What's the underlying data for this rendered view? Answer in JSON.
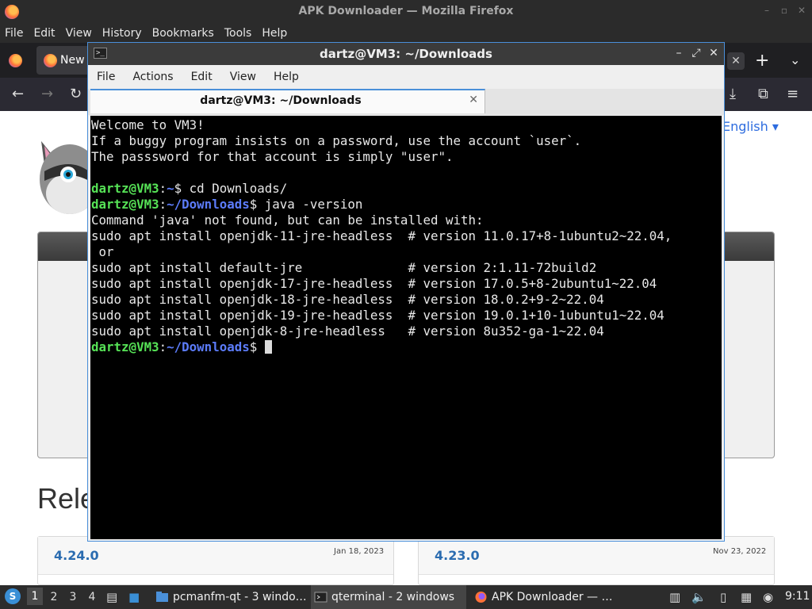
{
  "firefox": {
    "window_title": "APK Downloader — Mozilla Firefox",
    "menu": [
      "File",
      "Edit",
      "View",
      "History",
      "Bookmarks",
      "Tools",
      "Help"
    ],
    "tab_label": "New",
    "page": {
      "language": "English",
      "heading_partial": "Rele",
      "releases": [
        {
          "version": "4.24.0",
          "date": "Jan 18, 2023"
        },
        {
          "version": "4.23.0",
          "date": "Nov 23, 2022"
        }
      ]
    }
  },
  "terminal": {
    "window_title": "dartz@VM3: ~/Downloads",
    "menu": [
      "File",
      "Actions",
      "Edit",
      "View",
      "Help"
    ],
    "tab_label": "dartz@VM3: ~/Downloads",
    "lines": [
      {
        "text": "Welcome to VM3!"
      },
      {
        "text": "If a buggy program insists on a password, use the account `user`."
      },
      {
        "text": "The passsword for that account is simply \"user\"."
      },
      {
        "text": ""
      },
      {
        "user": "dartz@VM3",
        "path": "~",
        "cmd": "$ cd Downloads/"
      },
      {
        "user": "dartz@VM3",
        "path": "~/Downloads",
        "cmd": "$ java -version"
      },
      {
        "text": "Command 'java' not found, but can be installed with:"
      },
      {
        "text": "sudo apt install openjdk-11-jre-headless  # version 11.0.17+8-1ubuntu2~22.04,"
      },
      {
        "text": " or"
      },
      {
        "text": "sudo apt install default-jre              # version 2:1.11-72build2"
      },
      {
        "text": "sudo apt install openjdk-17-jre-headless  # version 17.0.5+8-2ubuntu1~22.04"
      },
      {
        "text": "sudo apt install openjdk-18-jre-headless  # version 18.0.2+9-2~22.04"
      },
      {
        "text": "sudo apt install openjdk-19-jre-headless  # version 19.0.1+10-1ubuntu1~22.04"
      },
      {
        "text": "sudo apt install openjdk-8-jre-headless   # version 8u352-ga-1~22.04"
      },
      {
        "user": "dartz@VM3",
        "path": "~/Downloads",
        "cmd": "$ ",
        "cursor": true
      }
    ]
  },
  "taskbar": {
    "workspaces": [
      "1",
      "2",
      "3",
      "4"
    ],
    "active_workspace": "1",
    "items": [
      {
        "label": "pcmanfm-qt - 3 windo…",
        "icon": "folder-icon"
      },
      {
        "label": "qterminal - 2 windows",
        "icon": "terminal-icon"
      },
      {
        "label": "APK Downloader — …",
        "icon": "firefox-icon"
      }
    ],
    "clock": "9:11"
  },
  "colors": {
    "prompt_user": "#56e256",
    "prompt_path": "#5c7cfa",
    "terminal_bg": "#000000",
    "accent_border": "#4a8fd9"
  }
}
